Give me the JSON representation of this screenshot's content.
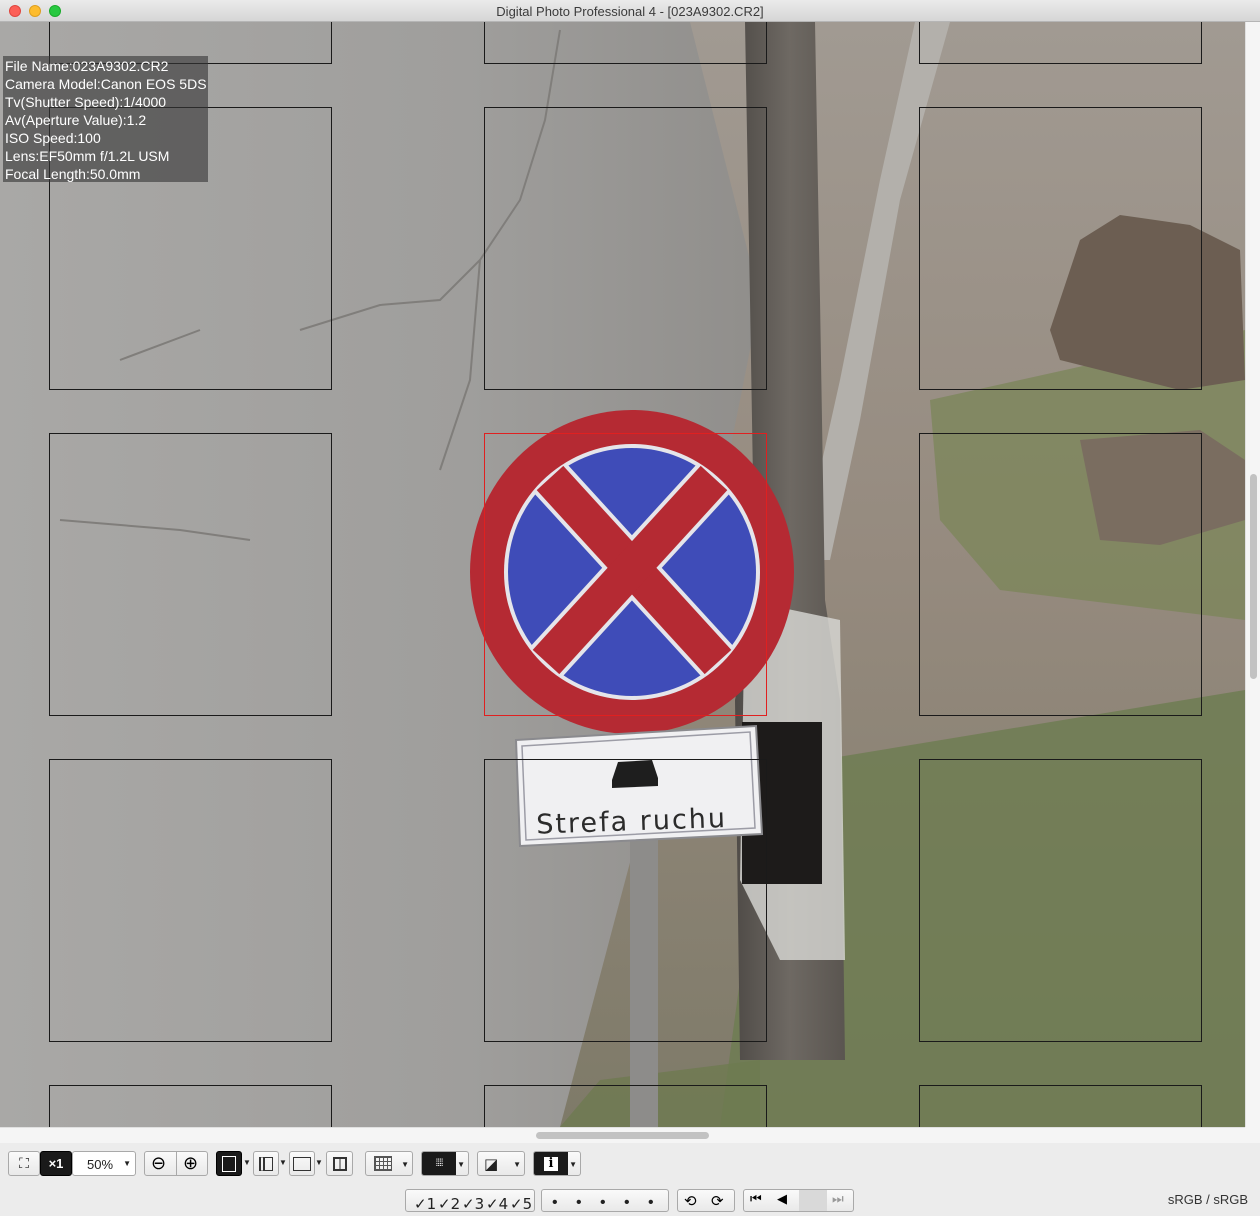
{
  "window": {
    "title": "Digital Photo Professional 4 - [023A9302.CR2]"
  },
  "info_panel": {
    "lines": [
      "File Name:023A9302.CR2",
      "Camera Model:Canon EOS 5DS",
      "Tv(Shutter Speed):1/4000",
      "Av(Aperture Value):1.2",
      "ISO Speed:100",
      "Lens:EF50mm f/1.2L USM",
      "Focal Length:50.0mm"
    ]
  },
  "photo": {
    "sign_text": "Strefa  ruchu"
  },
  "toolbar": {
    "zoom_x1": "×1",
    "zoom_level": "50%",
    "info_glyph": "i"
  },
  "statusbar": {
    "ratings": [
      "✓1",
      "✓2",
      "✓3",
      "✓4",
      "✓5"
    ],
    "color_space": "sRGB / sRGB"
  },
  "colors": {
    "selected_af_point": "#e02020",
    "af_point": "#1a1a1a"
  }
}
